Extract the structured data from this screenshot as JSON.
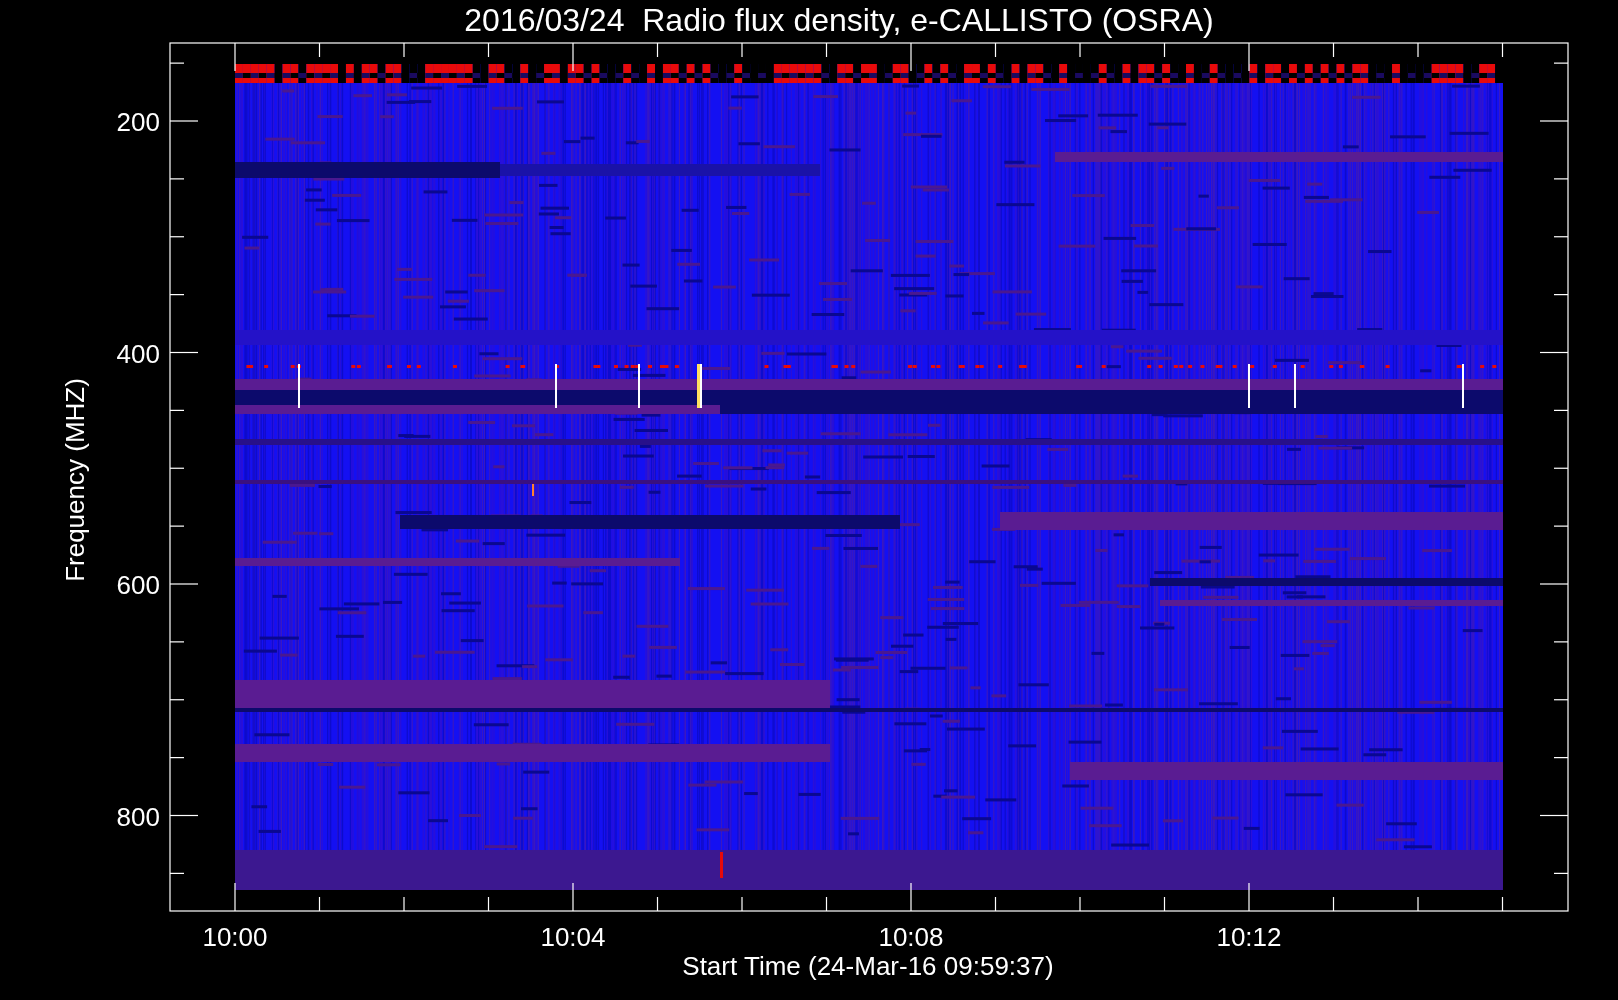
{
  "title": "2016/03/24  Radio flux density, e-CALLISTO (OSRA)",
  "y_axis": {
    "label": "Frequency (MHZ)",
    "ticks": [
      "200",
      "400",
      "600",
      "800"
    ]
  },
  "x_axis": {
    "label": "Start Time (24-Mar-16 09:59:37)",
    "ticks": [
      "10:00",
      "10:04",
      "10:08",
      "10:12"
    ]
  }
}
